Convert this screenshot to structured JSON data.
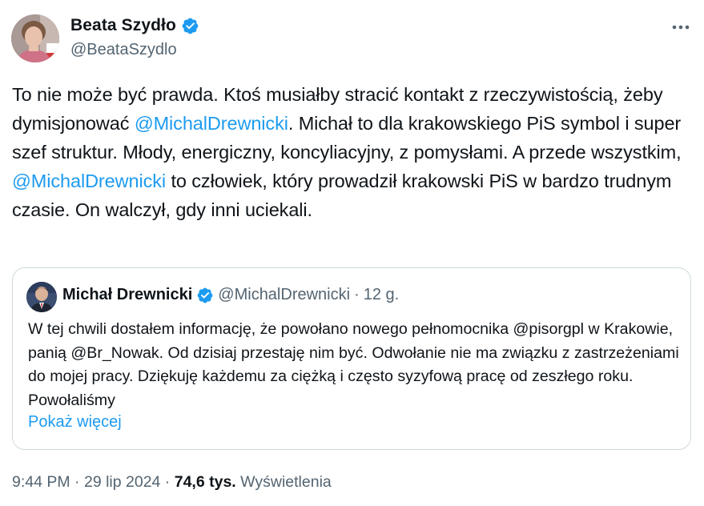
{
  "author": {
    "name": "Beata Szydło",
    "handle": "@BeataSzydlo",
    "verified": true,
    "verified_color": "#1d9bf0"
  },
  "tweet": {
    "text_1": "To nie może być prawda. Ktoś musiałby stracić kontakt z rzeczywistością, żeby dymisjonować ",
    "mention_1": "@MichalDrewnicki",
    "text_2": ". Michał to dla krakowskiego PiS symbol i super szef struktur. Młody, energiczny, koncyliacyjny, z pomysłami. A przede wszystkim, ",
    "mention_2": "@MichalDrewnicki",
    "text_3": " to człowiek, który prowadził krakowski PiS w bardzo trudnym czasie. On walczył, gdy inni uciekali."
  },
  "quote": {
    "name": "Michał Drewnicki",
    "verified": true,
    "handle": "@MichalDrewnicki",
    "separator": "·",
    "time": "12 g.",
    "text": "W tej chwili dostałem informację, że powołano nowego pełnomocnika @pisorgpl w Krakowie, panią @Br_Nowak. Od dzisiaj przestaję nim być. Odwołanie nie ma związku z zastrzeżeniami do mojej pracy. Dziękuję każdemu za ciężką i często syzyfową pracę od zeszłego roku. Powołaliśmy",
    "show_more": "Pokaż więcej"
  },
  "footer": {
    "time": "9:44 PM",
    "sep1": " · ",
    "date": "29 lip 2024",
    "sep2": " · ",
    "views_count": "74,6 tys.",
    "views_label": " Wyświetlenia"
  },
  "icons": {
    "more": "more-horizontal-icon",
    "verified": "verified-badge-icon"
  },
  "colors": {
    "link": "#1d9bf0",
    "text": "#0f1419",
    "secondary": "#536471",
    "border": "#cfd9de"
  }
}
